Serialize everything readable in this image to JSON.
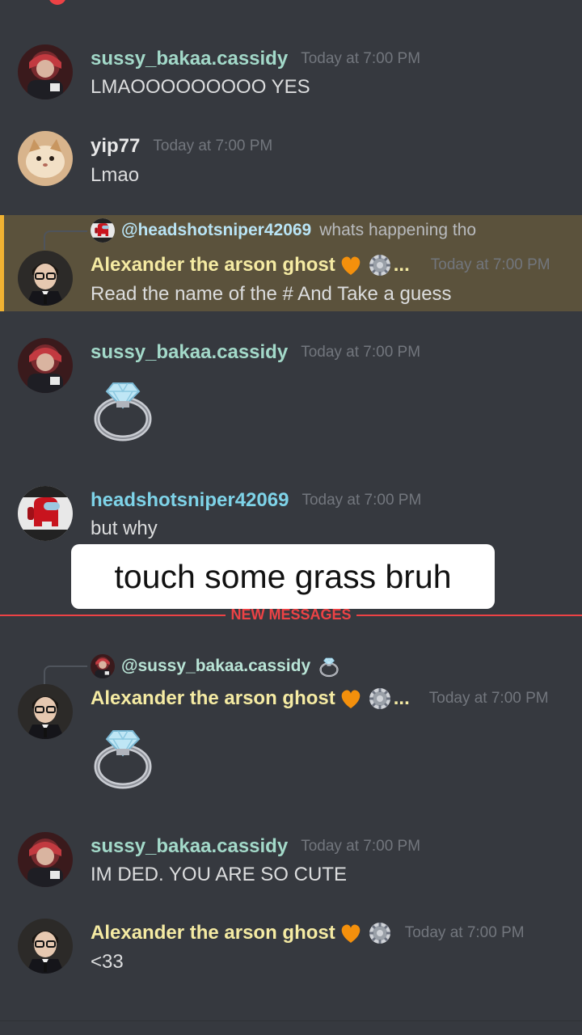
{
  "colors": {
    "background": "#36393f",
    "highlight_background": "#5b523c",
    "highlight_bar": "#f0b232",
    "new_messages": "#ed4245",
    "timestamp": "#72767d"
  },
  "messages": [
    {
      "username": "sussy_bakaa.cassidy",
      "timestamp": "Today at 7:00 PM",
      "text": "LMAOOOOOOOOO YES",
      "avatar_icon": "avatar-red-icon"
    },
    {
      "username": "yip77",
      "timestamp": "Today at 7:00 PM",
      "text": "Lmao",
      "avatar_icon": "avatar-cat-icon"
    },
    {
      "reply": {
        "user": "@headshotsniper42069",
        "text": "whats happening tho"
      },
      "username": "Alexander the arson ghost",
      "timestamp": "Today at 7:00 PM",
      "text": "Read the name of the # And Take a guess",
      "ellipsis": "...",
      "avatar_icon": "avatar-man-icon"
    },
    {
      "username": "sussy_bakaa.cassidy",
      "timestamp": "Today at 7:00 PM",
      "emoji": "ring-icon",
      "avatar_icon": "avatar-red-icon"
    },
    {
      "username": "headshotsniper42069",
      "timestamp": "Today at 7:00 PM",
      "text": "but why",
      "avatar_icon": "avatar-impostor-icon"
    },
    {
      "reply": {
        "user": "@sussy_bakaa.cassidy",
        "text_emoji": "ring-icon"
      },
      "username": "Alexander the arson ghost",
      "timestamp": "Today at 7:00 PM",
      "emoji": "ring-icon",
      "ellipsis": "...",
      "avatar_icon": "avatar-man-icon"
    },
    {
      "username": "sussy_bakaa.cassidy",
      "timestamp": "Today at 7:00 PM",
      "text": "IM DED. YOU ARE SO CUTE",
      "avatar_icon": "avatar-red-icon"
    },
    {
      "username": "Alexander the arson ghost",
      "timestamp": "Today at 7:00 PM",
      "text": "<33",
      "avatar_icon": "avatar-man-icon"
    }
  ],
  "caption": "touch some grass bruh",
  "new_messages_label": "NEW MESSAGES"
}
